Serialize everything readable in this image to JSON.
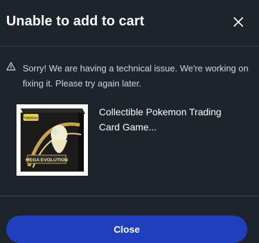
{
  "modal": {
    "title": "Unable to add to cart",
    "close_icon": "close-icon"
  },
  "warning": {
    "icon": "warning-triangle-icon",
    "message": "Sorry! We are having a technical issue. We're working on fixing it. Please try again later."
  },
  "product": {
    "name": "Collectible Pokemon Trading Card Game...",
    "image_label": "MEGA EVOLUTION",
    "image_brand": "Pokémon"
  },
  "footer": {
    "close_label": "Close"
  },
  "colors": {
    "background": "#1d252c",
    "primary_button": "#1f3fbf",
    "divider": "#3a4248",
    "text_secondary": "#d3d6d9"
  }
}
